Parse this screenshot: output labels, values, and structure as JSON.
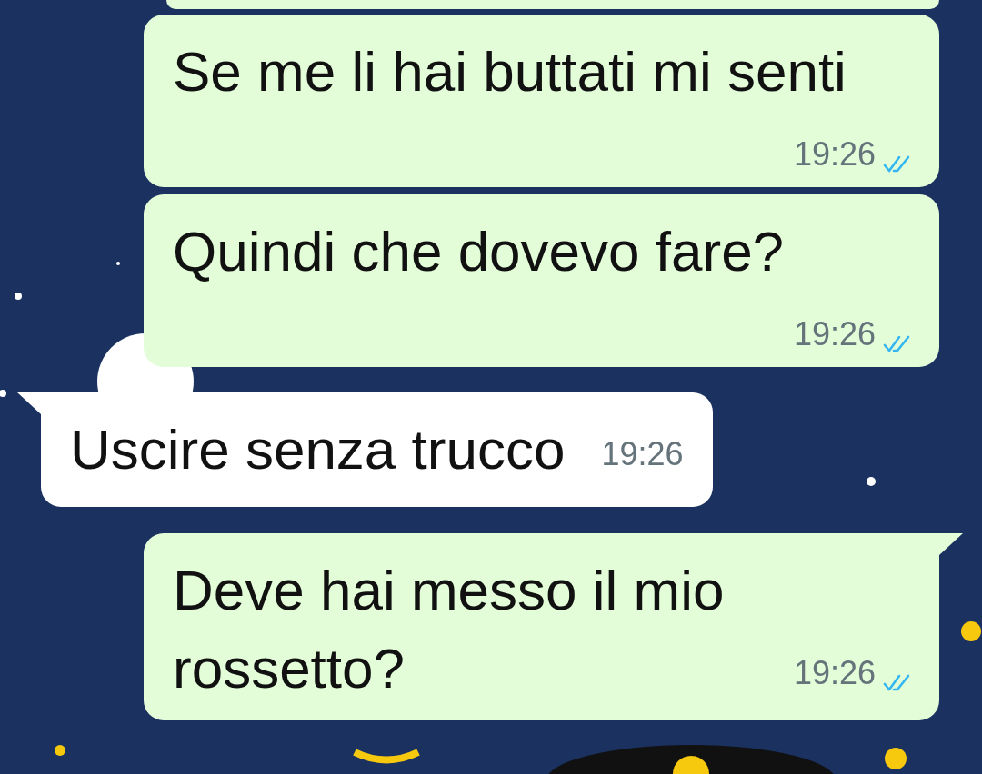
{
  "messages": [
    {
      "kind": "outgoing",
      "text": "Se me li hai buttati mi senti",
      "time": "19:26",
      "read": true,
      "tail": false
    },
    {
      "kind": "outgoing",
      "text": "Quindi che dovevo fare?",
      "time": "19:26",
      "read": true,
      "tail": false
    },
    {
      "kind": "incoming",
      "text": "Uscire senza trucco",
      "time": "19:26",
      "tail": true
    },
    {
      "kind": "outgoing",
      "text": "Deve hai messo il mio rossetto?",
      "time": "19:26",
      "read": true,
      "tail": true
    }
  ]
}
